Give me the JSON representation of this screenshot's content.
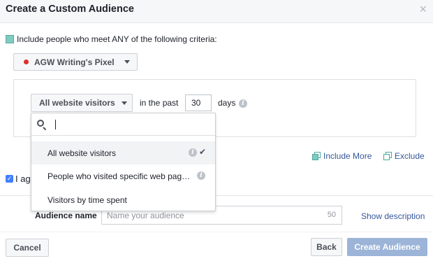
{
  "dialog": {
    "title": "Create a Custom Audience",
    "close_glyph": "×"
  },
  "criteria": {
    "include_text": "Include people who meet ANY of the following criteria:",
    "swatch_color": "#7fcbc1"
  },
  "pixel": {
    "label": "AGW Writing's Pixel",
    "status_color": "#e0302e"
  },
  "rule": {
    "visitors_selected": "All website visitors",
    "in_the_past_label": "in the past",
    "days_value": "30",
    "days_label": "days"
  },
  "dropdown": {
    "search_value": "",
    "options": [
      {
        "label": "All website visitors",
        "selected": true,
        "info_icon": true,
        "check_icon": true
      },
      {
        "label": "People who visited specific web pag…",
        "selected": false,
        "info_icon": true,
        "check_icon": false
      },
      {
        "label": "Visitors by time spent",
        "selected": false,
        "info_icon": false,
        "check_icon": false
      }
    ]
  },
  "actions": {
    "include_more": "Include More",
    "exclude": "Exclude"
  },
  "agree": {
    "text": "I ag",
    "checked": true
  },
  "audience": {
    "label": "Audience name",
    "placeholder": "Name your audience",
    "char_count": "50",
    "show_description": "Show description"
  },
  "footer": {
    "cancel": "Cancel",
    "back": "Back",
    "create": "Create Audience"
  },
  "colors": {
    "link": "#365899",
    "create_button_disabled": "#9cb4d8",
    "checkbox": "#4080ff"
  }
}
